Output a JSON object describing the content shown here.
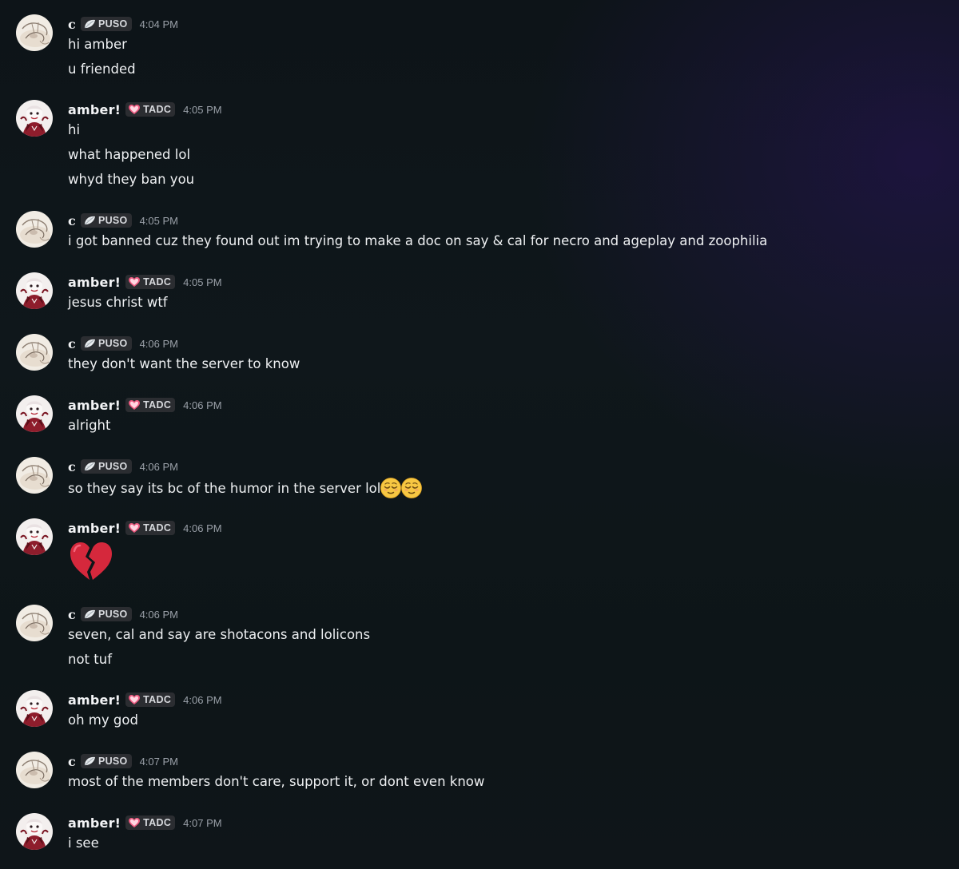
{
  "users": {
    "c": {
      "name": "c",
      "tag": "PUSO",
      "tag_icon": "leaf-icon"
    },
    "amber": {
      "name": "amber!",
      "tag": "TADC",
      "tag_icon": "heart-icon"
    }
  },
  "colors": {
    "tag_bg": "#2b2d31",
    "heart": "#e8517a",
    "broken_heart": "#d5283c"
  },
  "messages": [
    {
      "author": "c",
      "name": "c",
      "tag": "PUSO",
      "time": "4:04 PM",
      "lines": [
        "hi amber",
        "u friended"
      ]
    },
    {
      "author": "amber",
      "name": "amber!",
      "tag": "TADC",
      "time": "4:05 PM",
      "lines": [
        "hi",
        "what happened lol",
        "whyd they ban you"
      ]
    },
    {
      "author": "c",
      "name": "c",
      "tag": "PUSO",
      "time": "4:05 PM",
      "lines": [
        "i got banned cuz they found out im trying to make a doc on say & cal for necro and ageplay and zoophilia"
      ]
    },
    {
      "author": "amber",
      "name": "amber!",
      "tag": "TADC",
      "time": "4:05 PM",
      "lines": [
        "jesus christ wtf"
      ]
    },
    {
      "author": "c",
      "name": "c",
      "tag": "PUSO",
      "time": "4:06 PM",
      "lines": [
        "they don't want the server to know"
      ]
    },
    {
      "author": "amber",
      "name": "amber!",
      "tag": "TADC",
      "time": "4:06 PM",
      "lines": [
        "alright"
      ]
    },
    {
      "author": "c",
      "name": "c",
      "tag": "PUSO",
      "time": "4:06 PM",
      "lines": [
        "so they say its bc of the humor in the server lol"
      ],
      "trailing_emoji": [
        "relieved-face-emoji",
        "relieved-face-emoji"
      ]
    },
    {
      "author": "amber",
      "name": "amber!",
      "tag": "TADC",
      "time": "4:06 PM",
      "lines": [],
      "big_emoji": "broken-heart-emoji"
    },
    {
      "author": "c",
      "name": "c",
      "tag": "PUSO",
      "time": "4:06 PM",
      "lines": [
        "seven, cal and say are shotacons and lolicons",
        "not tuf"
      ]
    },
    {
      "author": "amber",
      "name": "amber!",
      "tag": "TADC",
      "time": "4:06 PM",
      "lines": [
        "oh my god"
      ]
    },
    {
      "author": "c",
      "name": "c",
      "tag": "PUSO",
      "time": "4:07 PM",
      "lines": [
        "most of the members don't care, support it, or dont even know"
      ]
    },
    {
      "author": "amber",
      "name": "amber!",
      "tag": "TADC",
      "time": "4:07 PM",
      "lines": [
        "i see"
      ]
    }
  ]
}
